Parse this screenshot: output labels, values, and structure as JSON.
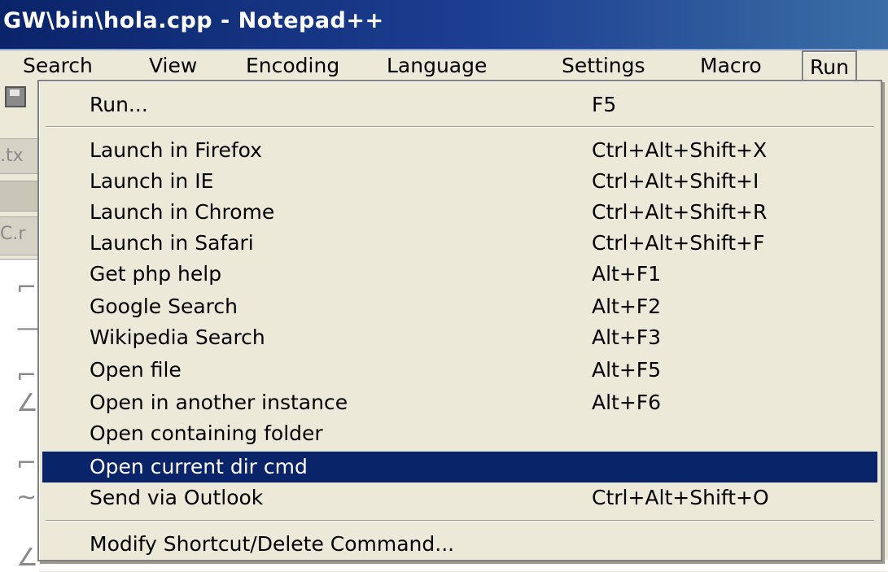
{
  "window": {
    "title": "GW\\bin\\hola.cpp - Notepad++"
  },
  "menubar": {
    "items": [
      {
        "label": "Search"
      },
      {
        "label": "View"
      },
      {
        "label": "Encoding"
      },
      {
        "label": "Language"
      },
      {
        "label": "Settings"
      },
      {
        "label": "Macro"
      },
      {
        "label": "Run"
      }
    ],
    "active": "Run"
  },
  "background": {
    "tab1": ".tx",
    "tab2": "C.r"
  },
  "run_menu": {
    "items": [
      {
        "label": "Run...",
        "shortcut": "F5"
      },
      {
        "label": "Launch in Firefox",
        "shortcut": "Ctrl+Alt+Shift+X"
      },
      {
        "label": "Launch in IE",
        "shortcut": "Ctrl+Alt+Shift+I"
      },
      {
        "label": "Launch in Chrome",
        "shortcut": "Ctrl+Alt+Shift+R"
      },
      {
        "label": "Launch in Safari",
        "shortcut": "Ctrl+Alt+Shift+F"
      },
      {
        "label": "Get php help",
        "shortcut": "Alt+F1"
      },
      {
        "label": "Google Search",
        "shortcut": "Alt+F2"
      },
      {
        "label": "Wikipedia Search",
        "shortcut": "Alt+F3"
      },
      {
        "label": "Open file",
        "shortcut": "Alt+F5"
      },
      {
        "label": "Open in another instance",
        "shortcut": "Alt+F6"
      },
      {
        "label": "Open containing folder",
        "shortcut": ""
      },
      {
        "label": "Open current dir cmd",
        "shortcut": ""
      },
      {
        "label": "Send via Outlook",
        "shortcut": "Ctrl+Alt+Shift+O"
      },
      {
        "label": "Modify Shortcut/Delete Command...",
        "shortcut": ""
      }
    ],
    "selected_item": "Open current dir cmd"
  },
  "colors": {
    "highlight": "#0a246a",
    "menu_background": "#ece9d8",
    "titlebar": "#0a246a"
  }
}
